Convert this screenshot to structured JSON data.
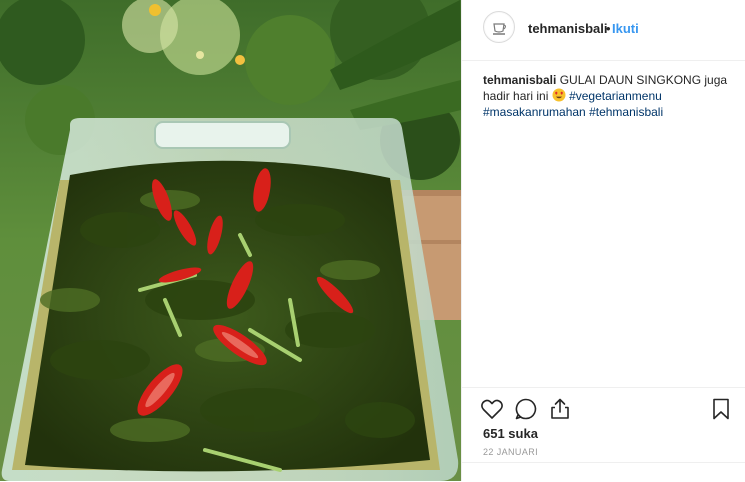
{
  "post": {
    "username": "tehmanisbali",
    "separator": "•",
    "follow_label": "Ikuti",
    "avatar_icon": "tehmanisbali-logo-icon",
    "caption": {
      "username": "tehmanisbali",
      "text": "GULAI DAUN SINGKONG juga hadir hari ini",
      "emoji": "heart-eyes-emoji",
      "hashtags": [
        "#vegetarianmenu",
        "#masakanrumahan",
        "#tehmanisbali"
      ]
    },
    "actions": {
      "like_icon": "heart-icon",
      "comment_icon": "comment-icon",
      "share_icon": "share-icon",
      "save_icon": "bookmark-icon"
    },
    "likes": "651 suka",
    "date": "22 JANUARI",
    "photo_subject": "cassava-leaf-curry-photo"
  },
  "colors": {
    "accent": "#3897f0",
    "hashtag": "#003569",
    "text": "#262626",
    "muted": "#999999",
    "border": "#efefef"
  }
}
